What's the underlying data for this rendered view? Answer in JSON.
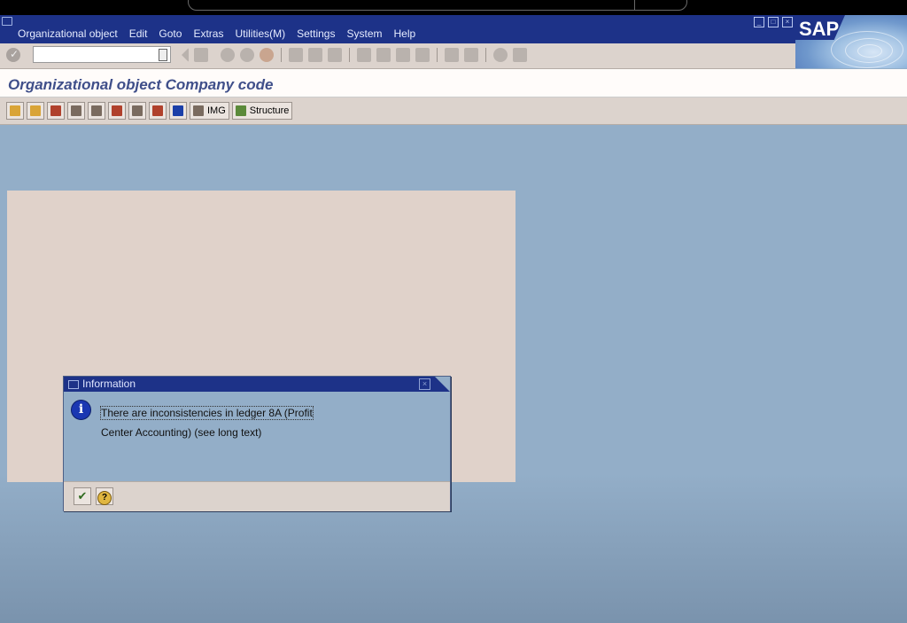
{
  "menubar": {
    "items": [
      "Organizational object",
      "Edit",
      "Goto",
      "Extras",
      "Utilities(M)",
      "Settings",
      "System",
      "Help"
    ],
    "logo": "SAP"
  },
  "toolbar": {
    "command_field_value": "",
    "icons": [
      "check-icon",
      "back-icon",
      "save-icon",
      "back-nav-icon",
      "exit-icon",
      "cancel-icon",
      "print-icon",
      "find-icon",
      "find-next-icon",
      "first-page-icon",
      "prev-page-icon",
      "next-page-icon",
      "last-page-icon",
      "new-session-icon",
      "shortcut-icon",
      "help-icon",
      "layout-icon"
    ]
  },
  "title": "Organizational object Company code",
  "app_toolbar": {
    "img_label": "IMG",
    "structure_label": "Structure"
  },
  "dialog": {
    "title": "Information",
    "message_line1": "There are inconsistencies in ledger 8A (Profit",
    "message_line2": "Center Accounting) (see long text)"
  },
  "colors": {
    "menubar": "#1d3288",
    "workarea": "#93aec8",
    "pane": "#e0d2ca",
    "toolbar": "#dcd3cd",
    "title_text": "#3f4f8a"
  }
}
